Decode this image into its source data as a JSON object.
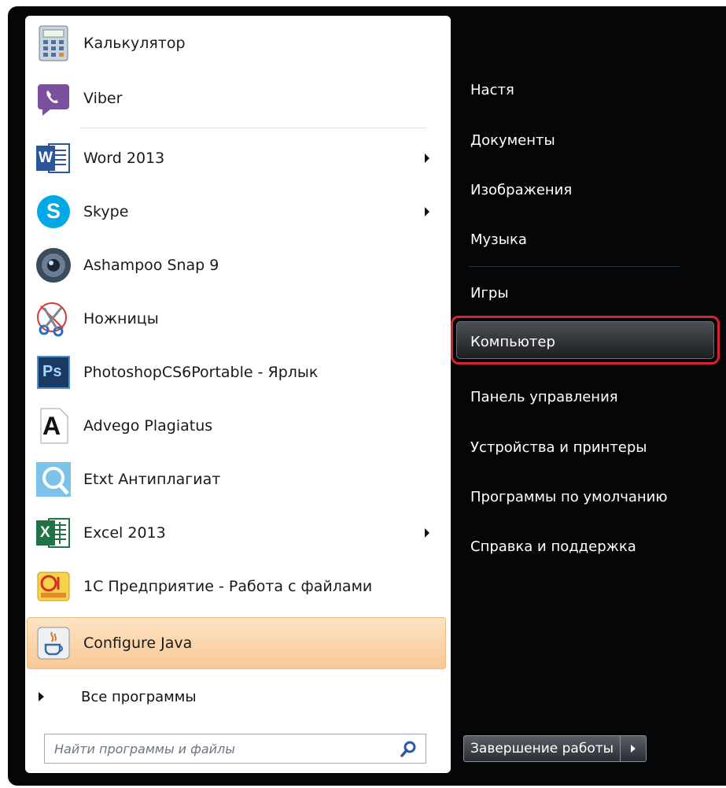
{
  "programs": [
    {
      "label": "Калькулятор",
      "icon": "calculator-icon",
      "submenu": false
    },
    {
      "label": "Viber",
      "icon": "viber-icon",
      "submenu": false
    },
    {
      "label": "Word 2013",
      "icon": "word-icon",
      "submenu": true
    },
    {
      "label": "Skype",
      "icon": "skype-icon",
      "submenu": true
    },
    {
      "label": "Ashampoo Snap 9",
      "icon": "ashampoo-snap-icon",
      "submenu": false
    },
    {
      "label": "Ножницы",
      "icon": "scissors-icon",
      "submenu": false
    },
    {
      "label": "PhotoshopCS6Portable - Ярлык",
      "icon": "photoshop-icon",
      "submenu": false
    },
    {
      "label": "Advego Plagiatus",
      "icon": "advego-icon",
      "submenu": false
    },
    {
      "label": "Etxt Антиплагиат",
      "icon": "etxt-icon",
      "submenu": false
    },
    {
      "label": "Excel 2013",
      "icon": "excel-icon",
      "submenu": true
    },
    {
      "label": "1С Предприятие - Работа с файлами",
      "icon": "1c-icon",
      "submenu": false
    },
    {
      "label": "Configure Java",
      "icon": "java-icon",
      "submenu": false
    }
  ],
  "icon_text": {
    "word": "W",
    "skype": "S",
    "photoshop": "Ps",
    "advego": "A",
    "excel": "X"
  },
  "all_programs": "Все программы",
  "search": {
    "placeholder": "Найти программы и файлы"
  },
  "right_menu": [
    "Настя",
    "Документы",
    "Изображения",
    "Музыка",
    "Игры",
    "Компьютер",
    "Панель управления",
    "Устройства и принтеры",
    "Программы по умолчанию",
    "Справка и поддержка"
  ],
  "highlighted_program": "Configure Java",
  "highlighted_right": "Компьютер",
  "shutdown": {
    "label": "Завершение работы"
  },
  "colors": {
    "frame": "#050608",
    "highlight_border": "#d6232f",
    "hover_program": "#f9c896"
  }
}
